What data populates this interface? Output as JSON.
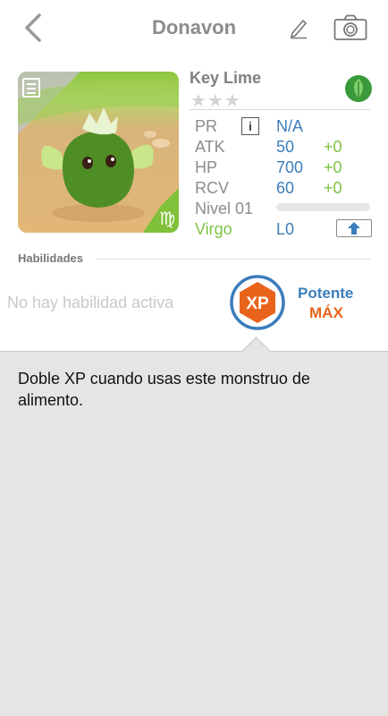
{
  "header": {
    "title": "Donavon",
    "back_icon": "chevron-left-icon",
    "edit_icon": "pencil-icon",
    "camera_icon": "camera-icon"
  },
  "monster": {
    "name": "Key Lime",
    "stars": "★★★",
    "star_count": 3,
    "element_icon": "leaf-icon",
    "zodiac_symbol": "♍",
    "portrait_badge_icon": "document-icon"
  },
  "stats": {
    "pr": {
      "label": "PR",
      "value": "N/A"
    },
    "atk": {
      "label": "ATK",
      "value": "50",
      "bonus": "+0"
    },
    "hp": {
      "label": "HP",
      "value": "700",
      "bonus": "+0"
    },
    "rcv": {
      "label": "RCV",
      "value": "60",
      "bonus": "+0"
    },
    "level": {
      "label": "Nivel 01",
      "progress": 0
    },
    "sign": {
      "label": "Virgo",
      "value": "L0"
    }
  },
  "skills": {
    "title": "Habilidades",
    "empty": "No hay habilidad activa",
    "xp_label": "XP",
    "potente": "Potente",
    "max": "MÁX"
  },
  "description": "Doble XP cuando usas este monstruo de alimento.",
  "colors": {
    "accent_blue": "#3b7dbb",
    "green": "#7dc242",
    "orange": "#e8641b",
    "panel": "#e5e5e5"
  }
}
